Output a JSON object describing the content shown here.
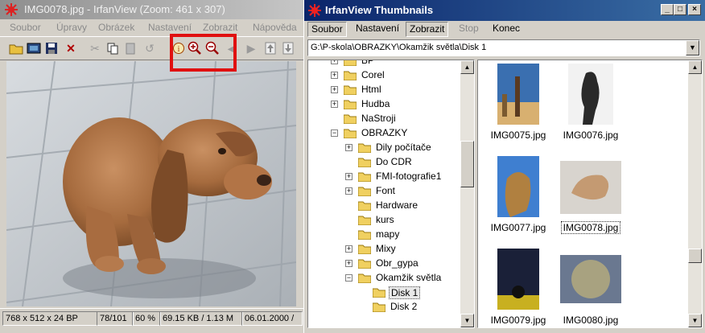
{
  "viewer": {
    "title": "IMG0078.jpg - IrfanView (Zoom: 461 x 307)",
    "menu": [
      "Soubor",
      "Úpravy",
      "Obrázek",
      "Nastavení",
      "Zobrazit",
      "Nápověda"
    ],
    "status": [
      "768 x 512 x 24 BP",
      "78/101",
      "60 %",
      "69.15 KB / 1.13 M",
      "06.01.2000 /"
    ]
  },
  "thumbs": {
    "title": "IrfanView Thumbnails",
    "menu": [
      "Soubor",
      "Nastavení",
      "Zobrazit",
      "Stop",
      "Konec"
    ],
    "path": "G:\\P-skola\\OBRAZKY\\Okamžik světla\\Disk 1",
    "tree": [
      {
        "label": "BP",
        "level": 1,
        "expander": "+"
      },
      {
        "label": "Corel",
        "level": 1,
        "expander": "+"
      },
      {
        "label": "Html",
        "level": 1,
        "expander": "+"
      },
      {
        "label": "Hudba",
        "level": 1,
        "expander": "+"
      },
      {
        "label": "NaStroji",
        "level": 1,
        "expander": ""
      },
      {
        "label": "OBRAZKY",
        "level": 1,
        "expander": "−"
      },
      {
        "label": "Dily počítače",
        "level": 2,
        "expander": "+"
      },
      {
        "label": "Do CDR",
        "level": 2,
        "expander": ""
      },
      {
        "label": "FMI-fotografie1",
        "level": 2,
        "expander": "+"
      },
      {
        "label": "Font",
        "level": 2,
        "expander": "+"
      },
      {
        "label": "Hardware",
        "level": 2,
        "expander": ""
      },
      {
        "label": "kurs",
        "level": 2,
        "expander": ""
      },
      {
        "label": "mapy",
        "level": 2,
        "expander": ""
      },
      {
        "label": "Mixy",
        "level": 2,
        "expander": "+"
      },
      {
        "label": "Obr_gypa",
        "level": 2,
        "expander": "+"
      },
      {
        "label": "Okamžik světla",
        "level": 2,
        "expander": "−"
      },
      {
        "label": "Disk 1",
        "level": 3,
        "expander": "",
        "selected": true
      },
      {
        "label": "Disk 2",
        "level": 3,
        "expander": ""
      }
    ],
    "files": [
      {
        "name": "IMG0075.jpg"
      },
      {
        "name": "IMG0076.jpg"
      },
      {
        "name": "IMG0077.jpg"
      },
      {
        "name": "IMG0078.jpg",
        "selected": true
      },
      {
        "name": "IMG0079.jpg"
      },
      {
        "name": "IMG0080.jpg"
      }
    ]
  },
  "colors": {
    "highlight_box": "#e01010",
    "active_title": "#0a246a",
    "folder": "#f0d060"
  }
}
